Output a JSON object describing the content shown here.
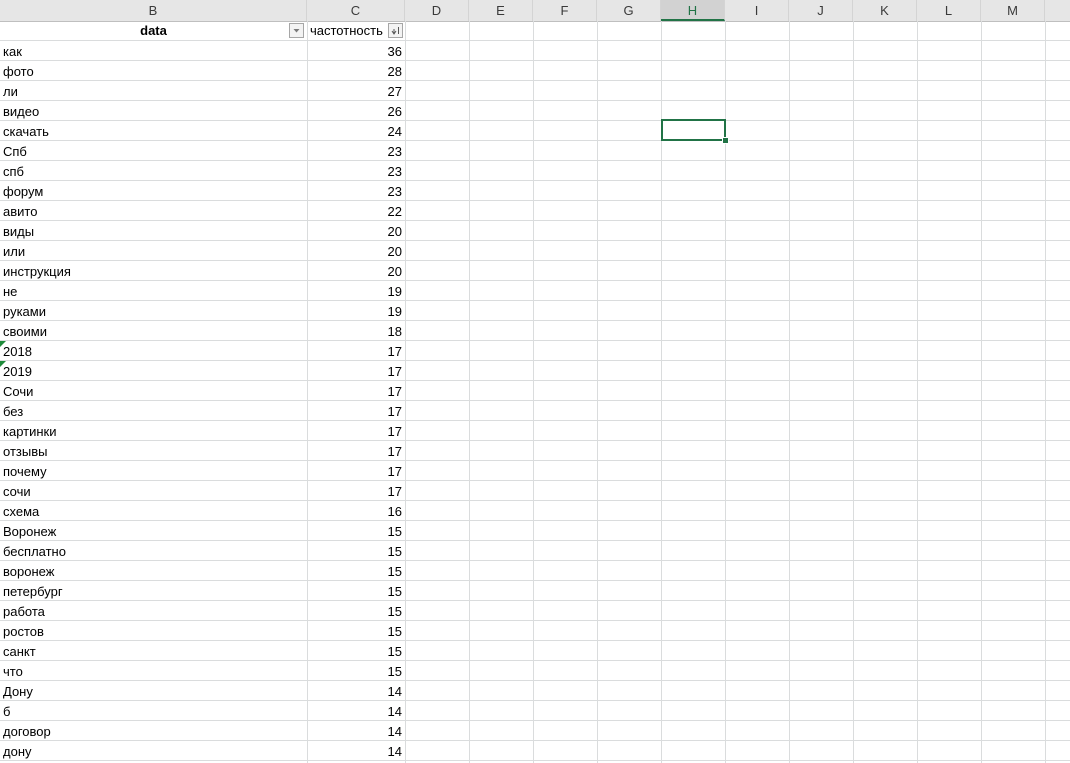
{
  "columns": [
    "B",
    "C",
    "D",
    "E",
    "F",
    "G",
    "H",
    "I",
    "J",
    "K",
    "L",
    "M"
  ],
  "active_column": "H",
  "header": {
    "data_label": "data",
    "freq_label": "частотность"
  },
  "rows": [
    {
      "word": "как",
      "count": "36"
    },
    {
      "word": "фото",
      "count": "28"
    },
    {
      "word": "ли",
      "count": "27"
    },
    {
      "word": "видео",
      "count": "26"
    },
    {
      "word": "скачать",
      "count": "24"
    },
    {
      "word": "Спб",
      "count": "23"
    },
    {
      "word": "спб",
      "count": "23"
    },
    {
      "word": "форум",
      "count": "23"
    },
    {
      "word": "авито",
      "count": "22"
    },
    {
      "word": "виды",
      "count": "20"
    },
    {
      "word": "или",
      "count": "20"
    },
    {
      "word": "инструкция",
      "count": "20"
    },
    {
      "word": "не",
      "count": "19"
    },
    {
      "word": "руками",
      "count": "19"
    },
    {
      "word": "своими",
      "count": "18"
    },
    {
      "word": "2018",
      "count": "17",
      "number_as_text": true
    },
    {
      "word": "2019",
      "count": "17",
      "number_as_text": true
    },
    {
      "word": "Сочи",
      "count": "17"
    },
    {
      "word": "без",
      "count": "17"
    },
    {
      "word": "картинки",
      "count": "17"
    },
    {
      "word": "отзывы",
      "count": "17"
    },
    {
      "word": "почему",
      "count": "17"
    },
    {
      "word": "сочи",
      "count": "17"
    },
    {
      "word": "схема",
      "count": "16"
    },
    {
      "word": "Воронеж",
      "count": "15"
    },
    {
      "word": "бесплатно",
      "count": "15"
    },
    {
      "word": "воронеж",
      "count": "15"
    },
    {
      "word": "петербург",
      "count": "15"
    },
    {
      "word": "работа",
      "count": "15"
    },
    {
      "word": "ростов",
      "count": "15"
    },
    {
      "word": "санкт",
      "count": "15"
    },
    {
      "word": "что",
      "count": "15"
    },
    {
      "word": "Дону",
      "count": "14"
    },
    {
      "word": "б",
      "count": "14"
    },
    {
      "word": "договор",
      "count": "14"
    },
    {
      "word": "дону",
      "count": "14"
    }
  ],
  "colors": {
    "accent": "#217346",
    "grid": "#dadcdd",
    "header_bg": "#e6e6e6"
  }
}
